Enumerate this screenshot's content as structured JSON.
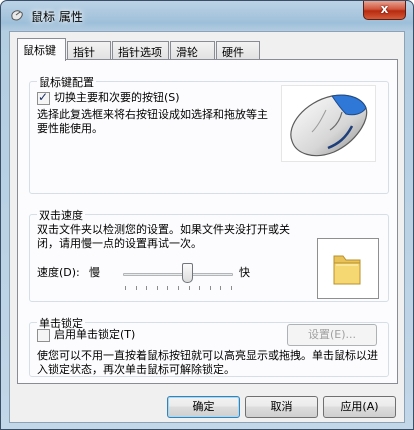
{
  "window": {
    "title": "鼠标 属性",
    "close_label": "x"
  },
  "tabs": [
    {
      "label": "鼠标键"
    },
    {
      "label": "指针"
    },
    {
      "label": "指针选项"
    },
    {
      "label": "滑轮"
    },
    {
      "label": "硬件"
    }
  ],
  "button_config": {
    "title": "鼠标键配置",
    "switch_label": "切换主要和次要的按钮(S)",
    "switch_checked": true,
    "description": "选择此复选框来将右按钮设成如选择和拖放等主要性能使用。"
  },
  "double_click": {
    "title": "双击速度",
    "description": "双击文件夹以检测您的设置。如果文件夹没打开或关闭，请用慢一点的设置再试一次。",
    "speed_label": "速度(D):",
    "slow_label": "慢",
    "fast_label": "快",
    "speed_level": 0.6
  },
  "click_lock": {
    "title": "单击锁定",
    "enable_label": "启用单击锁定(T)",
    "enable_checked": false,
    "settings_label": "设置(E)...",
    "description": "使您可以不用一直按着鼠标按钮就可以高亮显示或拖拽。单击鼠标以进入锁定状态，再次单击鼠标可解除锁定。"
  },
  "footer": {
    "ok_label": "确定",
    "cancel_label": "取消",
    "apply_label": "应用(A)"
  },
  "colors": {
    "accent": "#3c7fb1",
    "titlebar": "#9ebfd9",
    "close": "#c8432a"
  }
}
